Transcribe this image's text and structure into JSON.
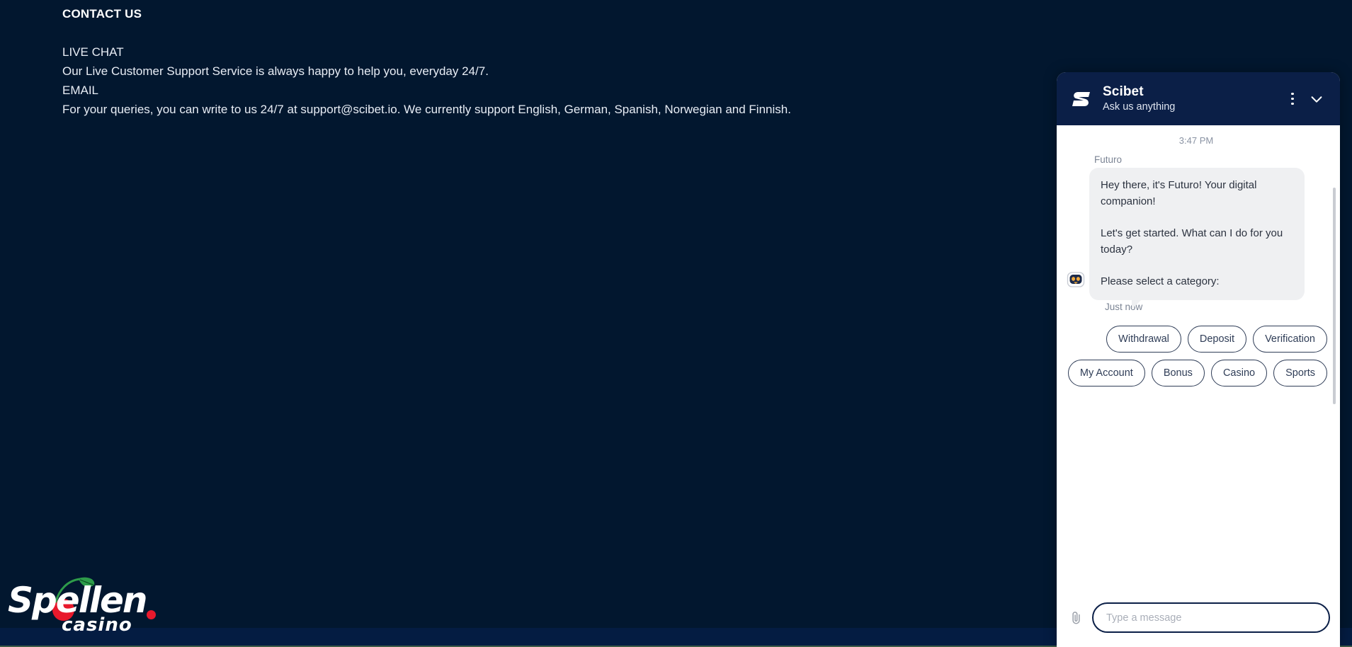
{
  "page": {
    "heading": "CONTACT US",
    "lines": [
      "LIVE CHAT",
      "Our Live Customer Support Service is always happy to help you, everyday 24/7.",
      "EMAIL",
      "For your queries, you can write to us 24/7 at support@scibet.io. We currently support English, German, Spanish, Norwegian and Finnish."
    ]
  },
  "logo": {
    "main": "Spellen",
    "sub": "casino",
    "cherry_color": "#e8192c",
    "stem_color": "#2e9c4a"
  },
  "colors": {
    "page_background": "#02172f",
    "bottom_strip": "#041c42",
    "widget_header": "#0b1f47",
    "bubble_background": "#eff0f2",
    "chip_border": "#2f3d57"
  },
  "chat": {
    "header": {
      "brand_logo_icon": "scibet-s-logo-icon",
      "title": "Scibet",
      "subtitle": "Ask us anything",
      "menu_icon": "kebab-menu-icon",
      "collapse_icon": "chevron-down-icon"
    },
    "conversation": {
      "timestamp": "3:47 PM",
      "sender": "Futuro",
      "avatar_icon": "robot-avatar-icon",
      "paragraphs": [
        "Hey there, it's Futuro! Your digital companion!",
        "Let's get started. What can I do for you today?",
        "Please select a category:"
      ],
      "relative_time": "Just now"
    },
    "quick_replies": [
      "Withdrawal",
      "Deposit",
      "Verification",
      "My Account",
      "Bonus",
      "Casino",
      "Sports"
    ],
    "footer": {
      "attach_icon": "paperclip-icon",
      "input_value": "",
      "input_placeholder": "Type a message"
    }
  }
}
